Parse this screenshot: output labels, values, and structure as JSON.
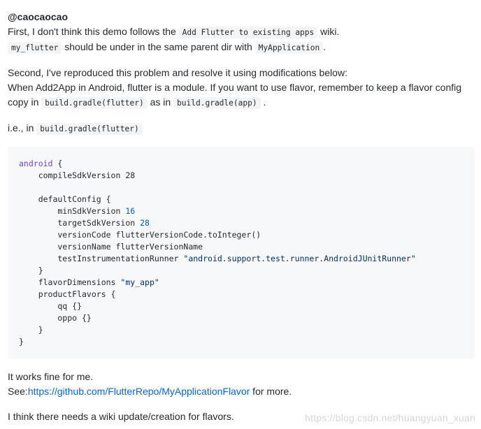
{
  "comment": {
    "author": "@caocaocao",
    "para1": {
      "line1_pre": "First, I don't think this demo follows the",
      "line1_code": "Add Flutter to existing apps",
      "line1_post": "wiki.",
      "line2_code1": "my_flutter",
      "line2_mid": "should be under in the same parent dir with",
      "line2_code2": "MyApplication",
      "line2_post": "."
    },
    "para2": {
      "line1": "Second, I've reproduced this problem and resolve it using modifications below:",
      "line2": "When Add2App in Android, flutter is a module. If you want to use flavor, remember to keep a flavor config",
      "line3_pre": "copy in",
      "line3_code1": "build.gradle(flutter)",
      "line3_mid": "as in",
      "line3_code2": "build.gradle(app)",
      "line3_post": "."
    },
    "para3": {
      "pre": "i.e., in",
      "code": "build.gradle(flutter)"
    },
    "code_block": {
      "l01_kw": "android",
      "l01_rest": " {",
      "l02": "    compileSdkVersion 28",
      "l03": "",
      "l04": "    defaultConfig {",
      "l05_pre": "        minSdkVersion ",
      "l05_num": "16",
      "l06_pre": "        targetSdkVersion ",
      "l06_num": "28",
      "l07": "        versionCode flutterVersionCode.toInteger()",
      "l08": "        versionName flutterVersionName",
      "l09_pre": "        testInstrumentationRunner ",
      "l09_str": "\"android.support.test.runner.AndroidJUnitRunner\"",
      "l10": "    }",
      "l11_pre": "    flavorDimensions ",
      "l11_str": "\"my_app\"",
      "l12": "    productFlavors {",
      "l13": "        qq {}",
      "l14": "        oppo {}",
      "l15": "    }",
      "l16": "}"
    },
    "para4": {
      "line1": "It works fine for me.",
      "line2_pre": "See:",
      "line2_link": "https://github.com/FlutterRepo/MyApplicationFlavor",
      "line2_post": " for more."
    },
    "para5": "I think there needs a wiki update/creation for flavors."
  },
  "watermark": "https://blog.csdn.net/huangyuan_xuan"
}
